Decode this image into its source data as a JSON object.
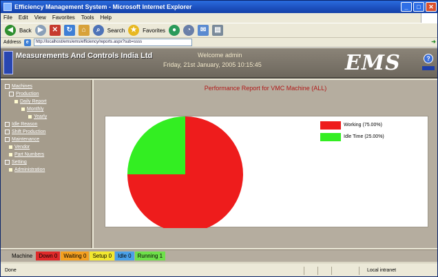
{
  "window": {
    "title": "Efficiency Management System - Microsoft Internet Explorer",
    "buttons": [
      "_",
      "□",
      "✕"
    ]
  },
  "menubar": [
    "File",
    "Edit",
    "View",
    "Favorites",
    "Tools",
    "Help"
  ],
  "toolbar": {
    "back_label": "Back",
    "search_label": "Search",
    "favorites_label": "Favorites"
  },
  "address": {
    "label": "Address",
    "value": "http://localhost/ems/ems/efficiency/reports.aspx?sub=ssss"
  },
  "header": {
    "company": "Measurements And Controls India Ltd",
    "welcome": "Welcome admin",
    "date": "Friday, 21st January, 2005 10:15:45",
    "logo_text": "EMS",
    "help_icon": "?"
  },
  "sidebar": {
    "items": [
      {
        "label": "Machines",
        "level": 0,
        "marker": "box"
      },
      {
        "label": "Production",
        "level": 1,
        "marker": "box"
      },
      {
        "label": "Daily Report",
        "level": 2,
        "marker": "dot"
      },
      {
        "label": "Monthly",
        "level": 3,
        "marker": "dot"
      },
      {
        "label": "Yearly",
        "level": 4,
        "marker": "dot"
      },
      {
        "label": "Idle Reason",
        "level": 0,
        "marker": "box"
      },
      {
        "label": "Shift Production",
        "level": 0,
        "marker": "box"
      },
      {
        "label": "Maintenance",
        "level": 0,
        "marker": "box"
      },
      {
        "label": "Vendor",
        "level": 1,
        "marker": "dot"
      },
      {
        "label": "Part Numbers",
        "level": 1,
        "marker": "dot"
      },
      {
        "label": "Setting",
        "level": 0,
        "marker": "box"
      },
      {
        "label": "Administration",
        "level": 1,
        "marker": "dot"
      }
    ]
  },
  "main": {
    "title": "Performance Report for VMC Machine (ALL)"
  },
  "chart_data": {
    "type": "pie",
    "title": "Performance Report for VMC Machine (ALL)",
    "slices": [
      {
        "label": "Working (75.00%)",
        "value": 75.0,
        "color": "#ee1c1c"
      },
      {
        "label": "Idle Time (25.00%)",
        "value": 25.0,
        "color": "#33ee22"
      }
    ],
    "legend_position": "top-right"
  },
  "statusbar": {
    "items": [
      {
        "label": "Machine",
        "color": "#b5ad9f"
      },
      {
        "label": "Down 0",
        "color": "#e02a2a"
      },
      {
        "label": "Waiting 0",
        "color": "#f4a020"
      },
      {
        "label": "Setup 0",
        "color": "#f2e830"
      },
      {
        "label": "Idle 0",
        "color": "#4aa0e8"
      },
      {
        "label": "Running 1",
        "color": "#6ee04a"
      }
    ]
  },
  "taskbar": {
    "done": "Done",
    "zone": "Local intranet"
  }
}
